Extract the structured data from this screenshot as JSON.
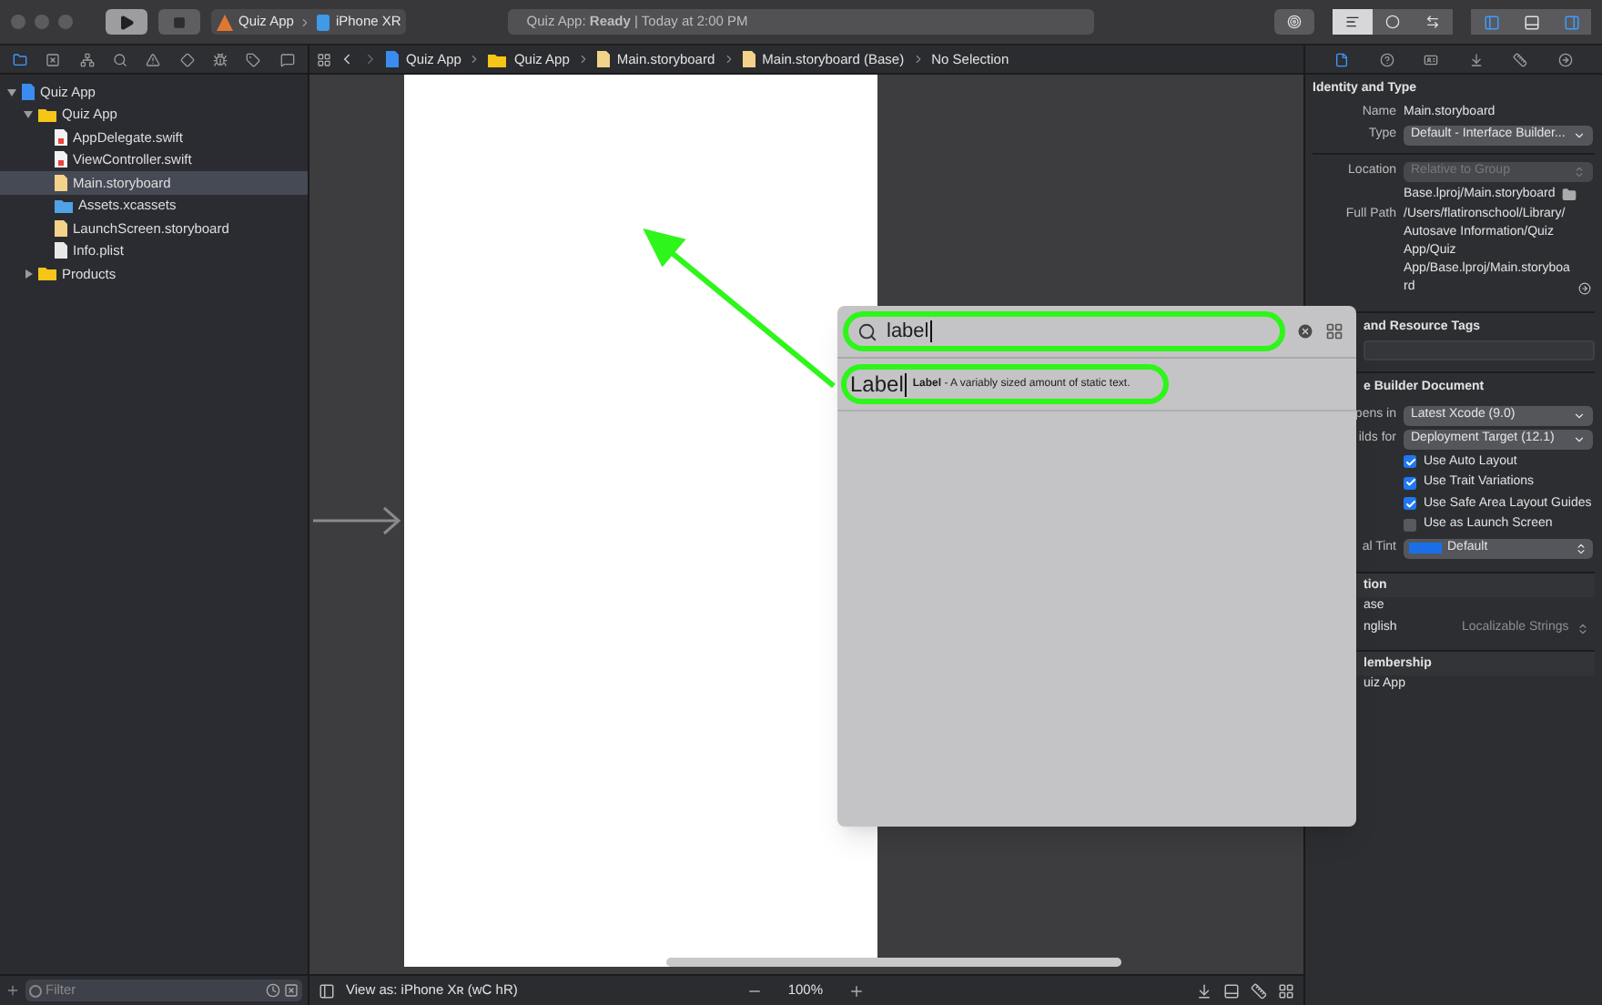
{
  "toolbar": {
    "scheme": "Quiz App",
    "device": "iPhone XR",
    "status": "Quiz App: **Ready** | Today at 2:00 PM",
    "editor_modes": [
      {
        "selected": true
      },
      {
        "selected": false
      },
      {
        "selected": false
      }
    ],
    "panels": [
      {
        "selected": true
      },
      {
        "selected": false
      },
      {
        "selected": true
      }
    ]
  },
  "navigator": {
    "tabs": [
      {
        "selected": true
      },
      {
        "selected": false
      },
      {
        "selected": false
      },
      {
        "selected": false
      },
      {
        "selected": false
      },
      {
        "selected": false
      },
      {
        "selected": false
      },
      {
        "selected": false
      },
      {
        "selected": false
      }
    ],
    "tree": [
      {
        "name": "Quiz App",
        "kind": "project",
        "expanded": true,
        "selected": false,
        "children": [
          {
            "name": "Quiz App",
            "kind": "folder",
            "expanded": true,
            "selected": false,
            "children": [
              {
                "name": "AppDelegate.swift",
                "kind": "swift",
                "selected": false
              },
              {
                "name": "ViewController.swift",
                "kind": "swift",
                "selected": false
              },
              {
                "name": "Main.storyboard",
                "kind": "storyboard",
                "selected": true
              },
              {
                "name": "Assets.xcassets",
                "kind": "assets",
                "selected": false
              },
              {
                "name": "LaunchScreen.storyboard",
                "kind": "storyboard",
                "selected": false
              },
              {
                "name": "Info.plist",
                "kind": "plist",
                "selected": false
              }
            ]
          },
          {
            "name": "Products",
            "kind": "folder",
            "expanded": false,
            "selected": false
          }
        ]
      }
    ],
    "filter_placeholder": "Filter"
  },
  "jump_bar": [
    {
      "label": "Quiz App",
      "kind": "project"
    },
    {
      "label": "Quiz App",
      "kind": "folder"
    },
    {
      "label": "Main.storyboard",
      "kind": "storyboard"
    },
    {
      "label": "Main.storyboard (Base)",
      "kind": "storyboard"
    },
    {
      "label": "No Selection",
      "kind": "none"
    }
  ],
  "library": {
    "search_value": "label",
    "results": [
      {
        "preview": "Label",
        "title": "Label",
        "description": " - A variably sized amount of static text."
      }
    ]
  },
  "canvas_footer": {
    "view_as": "View as: iPhone Xʀ (wC hR)",
    "zoom": "100%"
  },
  "inspector": {
    "tabs": [
      {
        "selected": true
      },
      {
        "selected": false
      },
      {
        "selected": false
      },
      {
        "selected": false
      },
      {
        "selected": false
      },
      {
        "selected": false
      }
    ],
    "identity": {
      "title": "Identity and Type",
      "name_label": "Name",
      "name": "Main.storyboard",
      "type_label": "Type",
      "type": "Default - Interface Builder...",
      "location_label": "Location",
      "location": "Relative to Group",
      "location_disabled": true,
      "path": "Base.lproj/Main.storyboard",
      "full_path_label": "Full Path",
      "full_path": "/Users/flatironschool/Library/Autosave Information/Quiz App/Quiz App/Base.lproj/Main.storyboard"
    },
    "tags_title": "and Resource Tags",
    "document": {
      "title": "e Builder Document",
      "opens_label": "pens in",
      "opens": "Latest Xcode (9.0)",
      "builds_label": "ilds for",
      "builds": "Deployment Target (12.1)",
      "options": [
        {
          "label": "Use Auto Layout",
          "checked": true
        },
        {
          "label": "Use Trait Variations",
          "checked": true
        },
        {
          "label": "Use Safe Area Layout Guides",
          "checked": true
        },
        {
          "label": "Use as Launch Screen",
          "checked": false
        }
      ],
      "tint_label": "al Tint",
      "tint": "Default"
    },
    "localization": {
      "title": "tion",
      "base": "ase",
      "language": "nglish",
      "type": "Localizable Strings"
    },
    "membership": {
      "title": "lembership",
      "target": "uiz App"
    }
  }
}
